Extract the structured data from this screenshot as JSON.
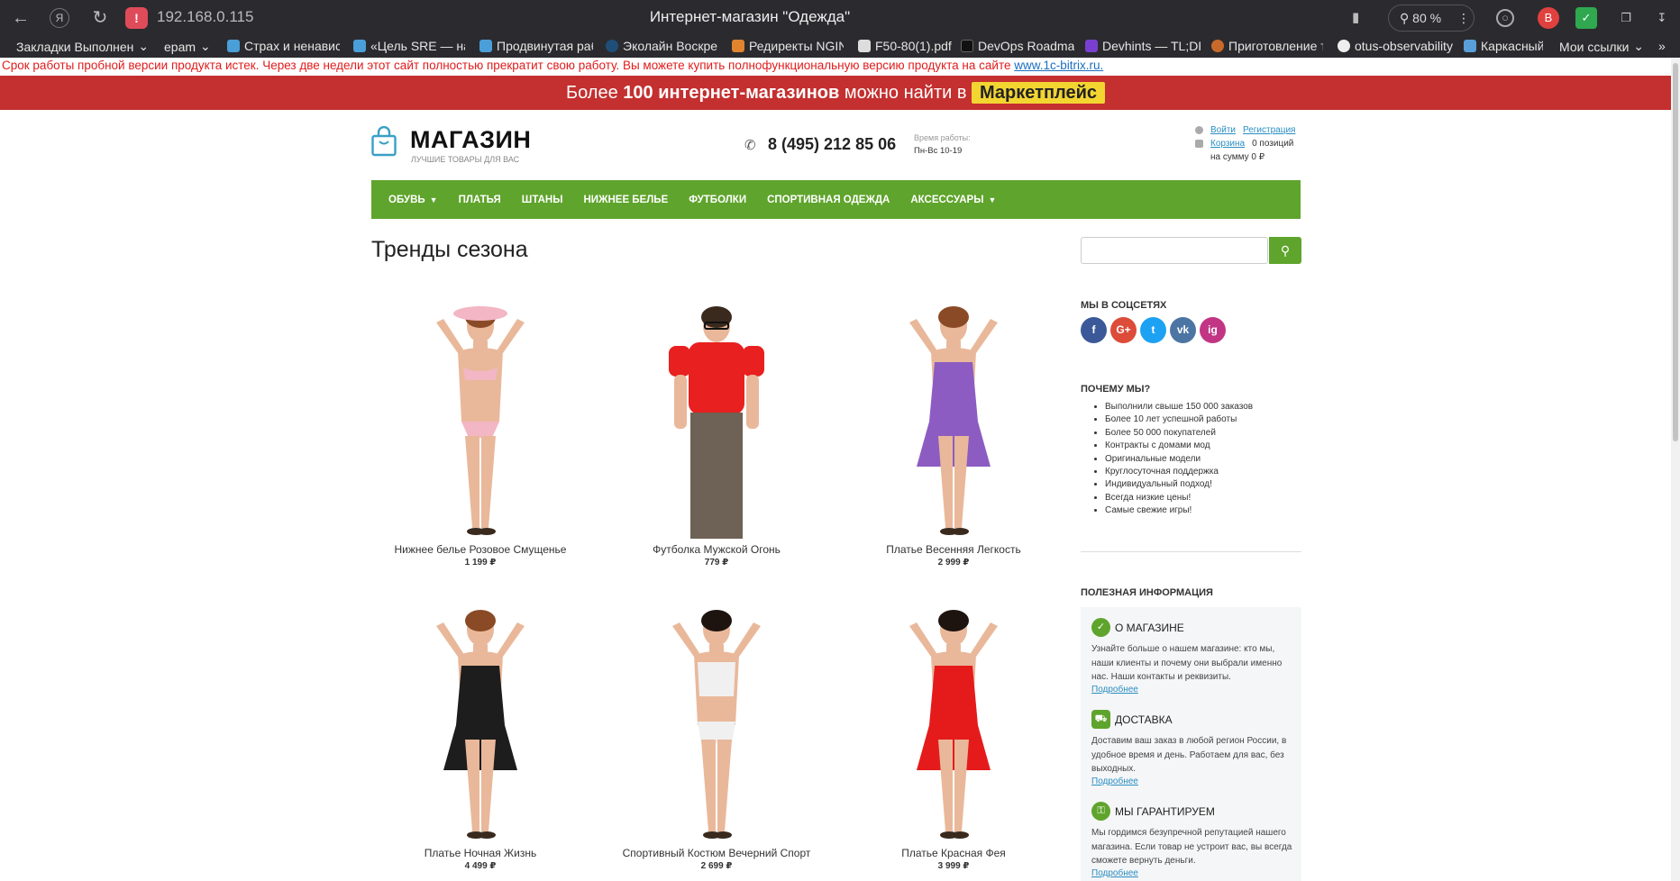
{
  "browser": {
    "url": "192.168.0.115",
    "window_title": "Интернет-магазин \"Одежда\"",
    "zoom": "80 %",
    "bookmarks": [
      {
        "label": "Закладки Выполнен",
        "color": "#2b2b2f"
      },
      {
        "label": "epam",
        "color": "#2b2b2f"
      },
      {
        "label": "Страх и ненавист",
        "color": "#4a9fd8"
      },
      {
        "label": "«Цель SRE — над",
        "color": "#4a9fd8"
      },
      {
        "label": "Продвинутая раб",
        "color": "#4a9fd8"
      },
      {
        "label": "Эколайн Воскрес",
        "color": "#1f4e7a"
      },
      {
        "label": "Редиректы NGINX",
        "color": "#e0852e"
      },
      {
        "label": "F50-80(1).pdf",
        "color": "#dddddd"
      },
      {
        "label": "DevOps Roadmap",
        "color": "#111111"
      },
      {
        "label": "Devhints — TL;DR",
        "color": "#7a3fd1"
      },
      {
        "label": "Приготовление т",
        "color": "#c96a2a"
      },
      {
        "label": "otus-observability",
        "color": "#eeeeee"
      },
      {
        "label": "Каркасный",
        "color": "#5aa0d8"
      },
      {
        "label": "Мои ссылки",
        "color": "#2b2b2f"
      }
    ]
  },
  "notice": {
    "trial_text": "Срок работы пробной версии продукта истек. Через две недели этот сайт полностью прекратит свою работу. Вы можете купить полнофункциональную версию продукта на сайте",
    "trial_link": "www.1c-bitrix.ru."
  },
  "promo": {
    "prefix": "Более",
    "bold": "100 интернет-магазинов",
    "suffix": "можно найти в",
    "button": "Маркетплейс"
  },
  "header": {
    "logo_title": "МАГАЗИН",
    "logo_subtitle": "ЛУЧШИЕ ТОВАРЫ ДЛЯ ВАС",
    "phone": "8 (495) 212 85 06",
    "hours_label": "Время работы:",
    "hours": "Пн-Вс 10-19",
    "login": "Войти",
    "register": "Регистрация",
    "cart": "Корзина",
    "cart_count": "0 позиций",
    "cart_sum": "на сумму 0 ₽"
  },
  "menu": [
    {
      "label": "ОБУВЬ",
      "dropdown": true
    },
    {
      "label": "ПЛАТЬЯ",
      "dropdown": false
    },
    {
      "label": "ШТАНЫ",
      "dropdown": false
    },
    {
      "label": "НИЖНЕЕ БЕЛЬЕ",
      "dropdown": false
    },
    {
      "label": "ФУТБОЛКИ",
      "dropdown": false
    },
    {
      "label": "СПОРТИВНАЯ ОДЕЖДА",
      "dropdown": false
    },
    {
      "label": "АКСЕССУАРЫ",
      "dropdown": true
    }
  ],
  "main": {
    "title": "Тренды сезона",
    "products": [
      {
        "name": "Нижнее белье Розовое Смущенье",
        "price": "1 199 ₽",
        "garment": "lingerie",
        "color": "#f3b6c4"
      },
      {
        "name": "Футболка Мужской Огонь",
        "price": "779 ₽",
        "garment": "tshirt",
        "color": "#e8201f"
      },
      {
        "name": "Платье Весенняя Легкость",
        "price": "2 999 ₽",
        "garment": "dress",
        "color": "#8c5cc2"
      },
      {
        "name": "Платье Ночная Жизнь",
        "price": "4 499 ₽",
        "garment": "dress",
        "color": "#1d1d1d"
      },
      {
        "name": "Спортивный Костюм Вечерний Спорт",
        "price": "2 699 ₽",
        "garment": "sport",
        "color": "#f0f0f0"
      },
      {
        "name": "Платье Красная Фея",
        "price": "3 999 ₽",
        "garment": "dress",
        "color": "#e51b1b"
      }
    ]
  },
  "sidebar": {
    "social_title": "МЫ В СОЦСЕТЯХ",
    "social": [
      {
        "label": "f",
        "color": "#3b5998"
      },
      {
        "label": "G+",
        "color": "#dd4b39"
      },
      {
        "label": "t",
        "color": "#1da1f2"
      },
      {
        "label": "vk",
        "color": "#4c75a3"
      },
      {
        "label": "ig",
        "color": "#c13584"
      }
    ],
    "why_title": "ПОЧЕМУ МЫ?",
    "why_items": [
      "Выполнили свыше 150 000 заказов",
      "Более 10 лет успешной работы",
      "Более 50 000 покупателей",
      "Контракты с домами мод",
      "Оригинальные модели",
      "Круглосуточная поддержка",
      "Индивидуальный подход!",
      "Всегда низкие цены!",
      "Самые свежие игры!"
    ],
    "info_title": "ПОЛЕЗНАЯ ИНФОРМАЦИЯ",
    "info": [
      {
        "title": "О МАГАЗИНЕ",
        "text": "Узнайте больше о нашем магазине: кто мы, наши клиенты и почему они выбрали именно нас. Наши контакты и реквизиты.",
        "more": "Подробнее"
      },
      {
        "title": "ДОСТАВКА",
        "text": "Доставим ваш заказ в любой регион России, в удобное время и день. Работаем для вас, без выходных.",
        "more": "Подробнее"
      },
      {
        "title": "МЫ ГАРАНТИРУЕМ",
        "text": "Мы гордимся безупречной репутацией нашего магазина. Если товар не устроит вас, вы всегда сможете вернуть деньги.",
        "more": "Подробнее"
      }
    ]
  }
}
